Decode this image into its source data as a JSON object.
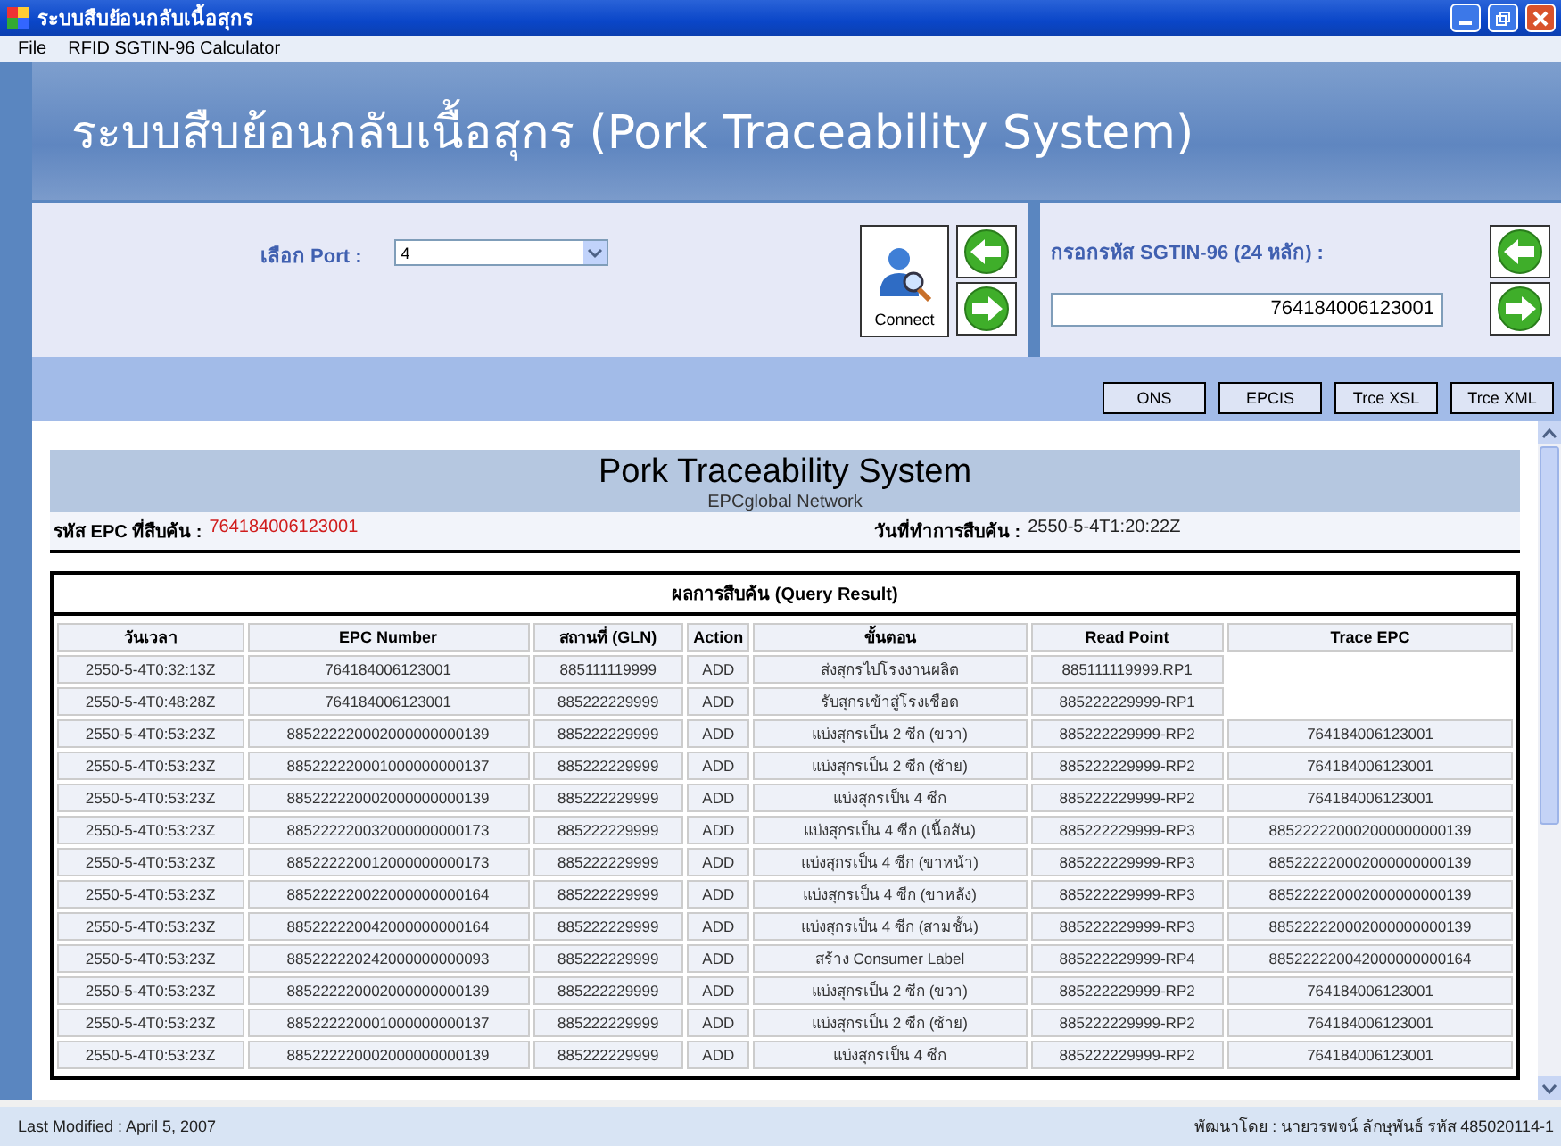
{
  "window": {
    "title": "ระบบสืบย้อนกลับเนื้อสุกร"
  },
  "menu": [
    "File",
    "RFID SGTIN-96 Calculator"
  ],
  "header": {
    "title": "ระบบสืบย้อนกลับเนื้อสุกร (Pork Traceability System)"
  },
  "port": {
    "label": "เลือก Port :",
    "value": "4"
  },
  "connect_button": {
    "label": "Connect"
  },
  "sgtin": {
    "label": "กรอกรหัส SGTIN-96 (24 หลัก) :",
    "value": "764184006123001"
  },
  "toolbar": [
    "ONS",
    "EPCIS",
    "Trce XSL",
    "Trce XML"
  ],
  "report": {
    "title": "Pork Traceability System",
    "subtitle": "EPCglobal Network",
    "epc_label": "รหัส EPC ที่สืบค้น :",
    "epc_value": "764184006123001",
    "date_label": "วันที่ทำการสืบค้น :",
    "date_value": "2550-5-4T1:20:22Z",
    "caption": "ผลการสืบค้น (Query Result)",
    "columns": [
      "วันเวลา",
      "EPC Number",
      "สถานที่ (GLN)",
      "Action",
      "ขั้นตอน",
      "Read Point",
      "Trace EPC"
    ],
    "rows": [
      {
        "time": "2550-5-4T0:32:13Z",
        "epc": "764184006123001",
        "gln": "885111119999",
        "action": "ADD",
        "step": "ส่งสุกรไปโรงงานผลิต",
        "read_point": "885111119999.RP1"
      },
      {
        "time": "2550-5-4T0:48:28Z",
        "epc": "764184006123001",
        "gln": "885222229999",
        "action": "ADD",
        "step": "รับสุกรเข้าสู่โรงเชือด",
        "read_point": "885222229999-RP1"
      },
      {
        "time": "2550-5-4T0:53:23Z",
        "epc": "885222220002000000000139",
        "gln": "885222229999",
        "action": "ADD",
        "step": "แบ่งสุกรเป็น 2 ซีก (ขวา)",
        "read_point": "885222229999-RP2",
        "trace_epc": "764184006123001"
      },
      {
        "time": "2550-5-4T0:53:23Z",
        "epc": "885222220001000000000137",
        "gln": "885222229999",
        "action": "ADD",
        "step": "แบ่งสุกรเป็น 2 ซีก (ซ้าย)",
        "read_point": "885222229999-RP2",
        "trace_epc": "764184006123001"
      },
      {
        "time": "2550-5-4T0:53:23Z",
        "epc": "885222220002000000000139",
        "gln": "885222229999",
        "action": "ADD",
        "step": "แบ่งสุกรเป็น 4 ซีก",
        "read_point": "885222229999-RP2",
        "trace_epc": "764184006123001"
      },
      {
        "time": "2550-5-4T0:53:23Z",
        "epc": "885222220032000000000173",
        "gln": "885222229999",
        "action": "ADD",
        "step": "แบ่งสุกรเป็น 4 ซีก (เนื้อสัน)",
        "read_point": "885222229999-RP3",
        "trace_epc": "885222220002000000000139"
      },
      {
        "time": "2550-5-4T0:53:23Z",
        "epc": "885222220012000000000173",
        "gln": "885222229999",
        "action": "ADD",
        "step": "แบ่งสุกรเป็น 4 ซีก (ขาหน้า)",
        "read_point": "885222229999-RP3",
        "trace_epc": "885222220002000000000139"
      },
      {
        "time": "2550-5-4T0:53:23Z",
        "epc": "885222220022000000000164",
        "gln": "885222229999",
        "action": "ADD",
        "step": "แบ่งสุกรเป็น 4 ซีก (ขาหลัง)",
        "read_point": "885222229999-RP3",
        "trace_epc": "885222220002000000000139"
      },
      {
        "time": "2550-5-4T0:53:23Z",
        "epc": "885222220042000000000164",
        "gln": "885222229999",
        "action": "ADD",
        "step": "แบ่งสุกรเป็น 4 ซีก (สามชั้น)",
        "read_point": "885222229999-RP3",
        "trace_epc": "885222220002000000000139"
      },
      {
        "time": "2550-5-4T0:53:23Z",
        "epc": "885222220242000000000093",
        "gln": "885222229999",
        "action": "ADD",
        "step": "สร้าง Consumer Label",
        "read_point": "885222229999-RP4",
        "trace_epc": "885222220042000000000164"
      },
      {
        "time": "2550-5-4T0:53:23Z",
        "epc": "885222220002000000000139",
        "gln": "885222229999",
        "action": "ADD",
        "step": "แบ่งสุกรเป็น 2 ซีก (ขวา)",
        "read_point": "885222229999-RP2",
        "trace_epc": "764184006123001"
      },
      {
        "time": "2550-5-4T0:53:23Z",
        "epc": "885222220001000000000137",
        "gln": "885222229999",
        "action": "ADD",
        "step": "แบ่งสุกรเป็น 2 ซีก (ซ้าย)",
        "read_point": "885222229999-RP2",
        "trace_epc": "764184006123001"
      },
      {
        "time": "2550-5-4T0:53:23Z",
        "epc": "885222220002000000000139",
        "gln": "885222229999",
        "action": "ADD",
        "step": "แบ่งสุกรเป็น 4 ซีก",
        "read_point": "885222229999-RP2",
        "trace_epc": "764184006123001"
      }
    ]
  },
  "status_bar": {
    "left": "Last Modified : April 5, 2007",
    "right": "พัฒนาโดย : นายวรพจน์ ลักษุพันธ์ รหัส 485020114-1"
  }
}
